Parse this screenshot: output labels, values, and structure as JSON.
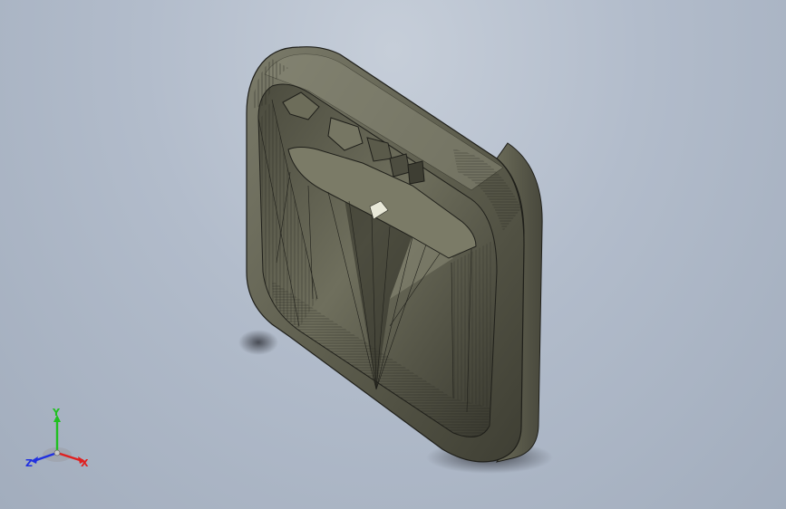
{
  "viewport": {
    "background_top": "#c6ced9",
    "background_bottom": "#a2adbd",
    "model_color": "#5a5a48"
  },
  "triad": {
    "x_label": "X",
    "y_label": "Y",
    "z_label": "Z",
    "x_color": "#e02020",
    "y_color": "#20c020",
    "z_color": "#2030e0"
  }
}
